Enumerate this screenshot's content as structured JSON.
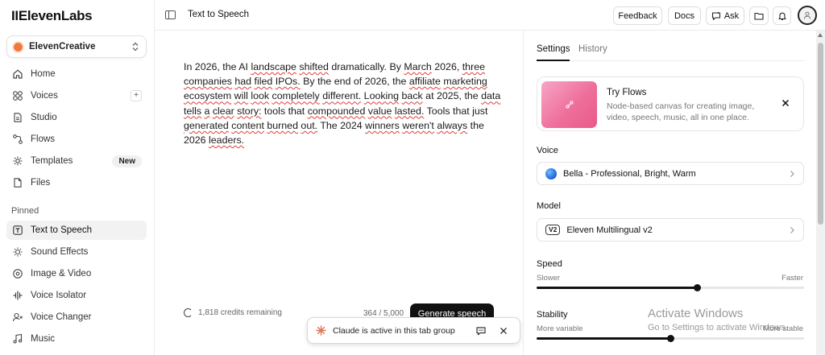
{
  "app": {
    "logo": "IIElevenLabs"
  },
  "workspace": {
    "name": "ElevenCreative"
  },
  "sidebar": {
    "items": [
      {
        "label": "Home"
      },
      {
        "label": "Voices",
        "action": "+"
      },
      {
        "label": "Studio"
      },
      {
        "label": "Flows"
      },
      {
        "label": "Templates",
        "badge": "New"
      },
      {
        "label": "Files"
      }
    ],
    "pinned_heading": "Pinned",
    "pinned": [
      {
        "label": "Text to Speech",
        "active": true
      },
      {
        "label": "Sound Effects"
      },
      {
        "label": "Image & Video"
      },
      {
        "label": "Voice Isolator"
      },
      {
        "label": "Voice Changer"
      },
      {
        "label": "Music"
      }
    ]
  },
  "topbar": {
    "title": "Text to Speech",
    "feedback": "Feedback",
    "docs": "Docs",
    "ask": "Ask"
  },
  "editor": {
    "text": "In 2026, the AI landscape shifted dramatically. By March 2026, three companies had filed IPOs. By the end of 2026, the affiliate marketing ecosystem will look completely different. Looking back at 2025, the data tells a clear story: tools that compounded value lasted. Tools that just generated content burned out. The 2024 winners weren't always the 2026 leaders.",
    "credits": "1,818 credits remaining",
    "char_count": "364 / 5,000",
    "generate_label": "Generate speech"
  },
  "toast": {
    "text": "Claude is active in this tab group"
  },
  "settings": {
    "tabs": [
      {
        "label": "Settings",
        "active": true
      },
      {
        "label": "History"
      }
    ],
    "flows_card": {
      "title": "Try Flows",
      "description": "Node-based canvas for creating image, video, speech, music, all in one place."
    },
    "voice_label": "Voice",
    "voice_value": "Bella - Professional, Bright, Warm",
    "model_label": "Model",
    "model_badge": "V2",
    "model_value": "Eleven Multilingual v2",
    "speed": {
      "label": "Speed",
      "min_label": "Slower",
      "max_label": "Faster",
      "value": 0.6
    },
    "stability": {
      "label": "Stability",
      "min_label": "More variable",
      "max_label": "More stable",
      "value": 0.5
    }
  },
  "watermark": {
    "title": "Activate Windows",
    "subtitle": "Go to Settings to activate Windows."
  },
  "colors": {
    "accent": "#111111",
    "workspace_dot": "#f0783c",
    "flows_thumb": "#ef6f9b",
    "toast_icon": "#d97757"
  }
}
